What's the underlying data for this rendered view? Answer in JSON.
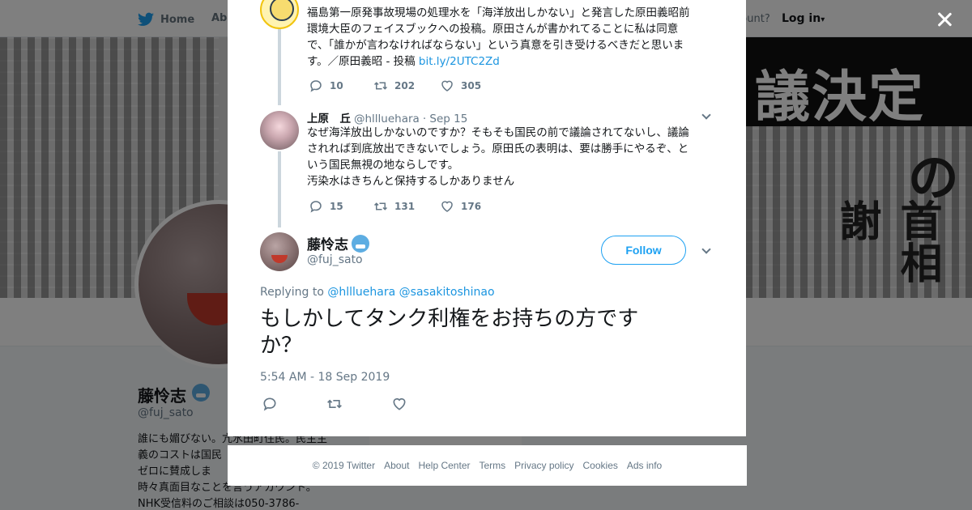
{
  "nav": {
    "home_label": "Home",
    "about_label": "Abo",
    "account_prompt": "ccount?",
    "login_label": "Log in"
  },
  "banner": {
    "headline": "議決定",
    "vertical_heads": [
      "拒否の",
      "首相謝"
    ]
  },
  "profile": {
    "name": "藤怜志",
    "handle": "@fuj_sato",
    "bio": "誰にも媚びない。亢水田町住民。民主主\n義のコストは国民\nゼロに賛成しま\n時々真面目なことを言うアカウント。\nNHK受信料のご相談は050-3786-"
  },
  "thread": {
    "tweet1": {
      "text": "福島第一原発事故現場の処理水を「海洋放出しかない」と発言した原田義昭前\n環境大臣のフェイスブックへの投稿。原田さんが書かれてることに私は同意\nで、「誰かが言わなければならない」という真意を引き受けるべきだと思いま\nす。／原田義昭 - 投稿 ",
      "link": "bit.ly/2UTC2Zd",
      "replies": "10",
      "retweets": "202",
      "likes": "305"
    },
    "tweet2": {
      "name": "上原　丘",
      "handle": "@hllluehara",
      "date": "· Sep 15",
      "text": "なぜ海洋放出しかないのですか？そもそも国民の前で議論されてないし、議論\nされれば到底放出できないでしょう。原田氏の表明は、要は勝手にやるぞ、と\nいう国民無視の地ならしです。\n汚染水はきちんと保持するしかありません",
      "replies": "15",
      "retweets": "131",
      "likes": "176"
    },
    "main": {
      "name": "藤怜志",
      "handle": "@fuj_sato",
      "follow_label": "Follow",
      "replying_prefix": "Replying to ",
      "reply_user1": "@hllluehara",
      "reply_user2": "@sasakitoshinao",
      "text": "もしかしてタンク利権をお持ちの方です\nか？",
      "timestamp": "5:54 AM - 18 Sep 2019"
    }
  },
  "footer": {
    "links": [
      "© 2019 Twitter",
      "About",
      "Help Center",
      "Terms",
      "Privacy policy",
      "Cookies",
      "Ads info"
    ]
  },
  "colors": {
    "accent": "#1da1f2",
    "link": "#1b95e0",
    "muted": "#657786"
  },
  "icons": [
    "twitter-bird-icon",
    "close-icon",
    "reply-icon",
    "retweet-icon",
    "like-icon",
    "chevron-down-icon",
    "emoji-badge-icon"
  ]
}
